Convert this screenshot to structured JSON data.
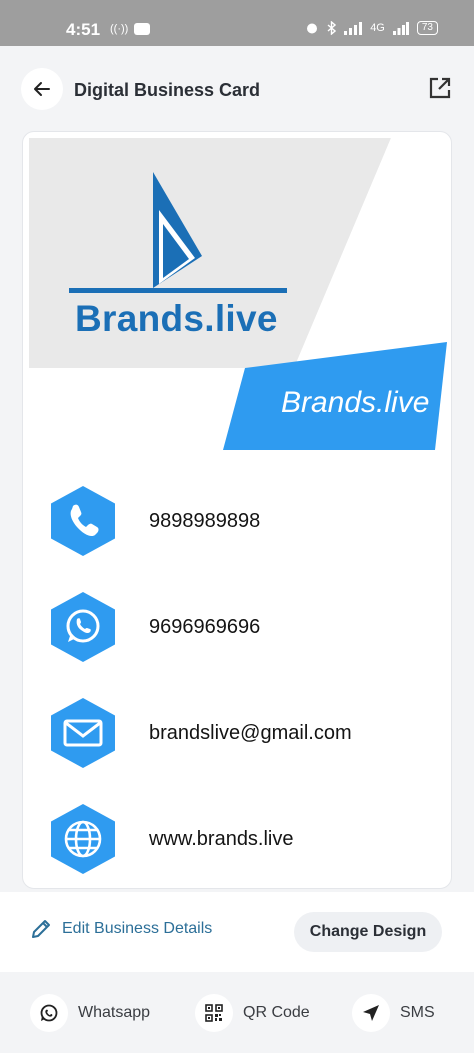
{
  "status_bar": {
    "time": "4:51",
    "network_label": "4G",
    "battery": "73"
  },
  "header": {
    "title": "Digital Business Card",
    "back_icon": "arrow-left-icon",
    "share_icon": "external-link-icon"
  },
  "card": {
    "logo_text": "Brands.live",
    "banner_text": "Brands.live",
    "colors": {
      "accent": "#2f9bf0",
      "logo_blue": "#1b6fb6",
      "hero_gray": "#e9e9e9"
    },
    "contacts": [
      {
        "icon": "phone-icon",
        "value": "9898989898"
      },
      {
        "icon": "whatsapp-icon",
        "value": "9696969696"
      },
      {
        "icon": "mail-icon",
        "value": "brandslive@gmail.com"
      },
      {
        "icon": "globe-icon",
        "value": "www.brands.live"
      }
    ]
  },
  "actions": {
    "edit_label": "Edit Business Details",
    "change_design_label": "Change Design"
  },
  "share_bar": {
    "items": [
      {
        "icon": "whatsapp-icon",
        "label": "Whatsapp"
      },
      {
        "icon": "qr-code-icon",
        "label": "QR Code"
      },
      {
        "icon": "send-icon",
        "label": "SMS"
      }
    ]
  }
}
